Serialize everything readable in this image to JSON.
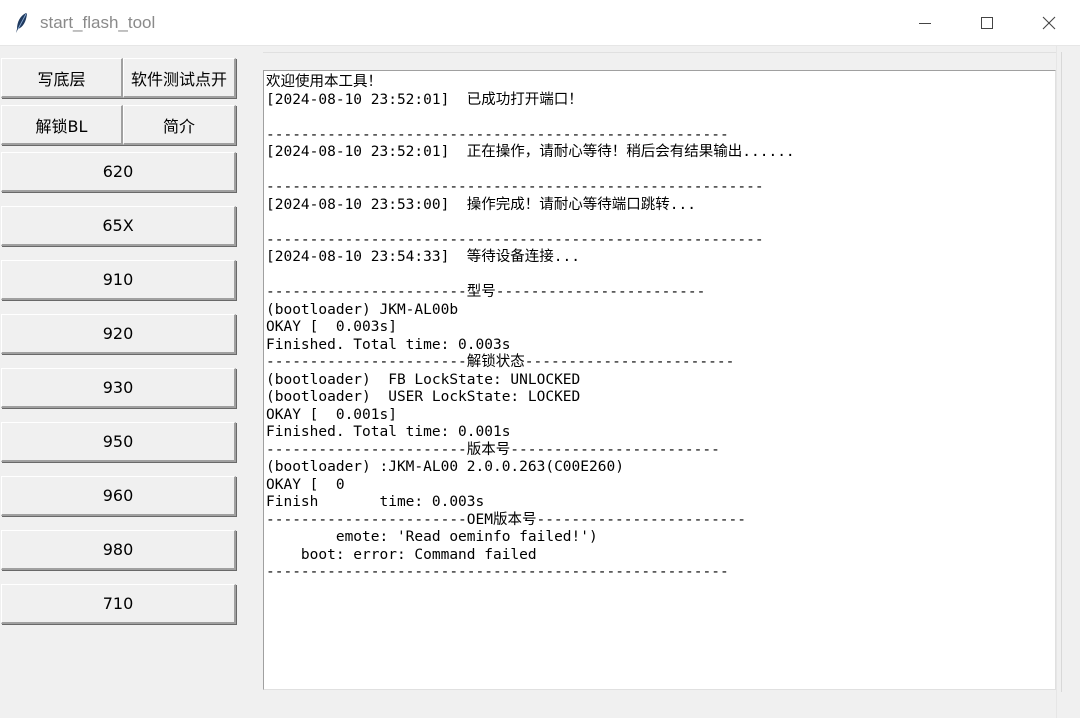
{
  "window": {
    "title": "start_flash_tool",
    "icon": "feather-icon",
    "controls": [
      "minimize-icon",
      "maximize-icon",
      "close-icon"
    ]
  },
  "buttons": {
    "write_base": "写底层",
    "software_test_point": "软件测试点开",
    "unlock_bl": "解锁BL",
    "intro": "简介",
    "models": [
      "620",
      "65X",
      "910",
      "920",
      "930",
      "950",
      "960",
      "980",
      "710"
    ]
  },
  "log": {
    "text": "欢迎使用本工具！\n[2024-08-10 23:52:01]  已成功打开端口！\n\n-----------------------------------------------------\n[2024-08-10 23:52:01]  正在操作，请耐心等待！稍后会有结果输出......\n\n---------------------------------------------------------\n[2024-08-10 23:53:00]  操作完成！请耐心等待端口跳转...\n\n---------------------------------------------------------\n[2024-08-10 23:54:33]  等待设备连接...\n\n-----------------------型号------------------------\n(bootloader) JKM-AL00b\nOKAY [  0.003s]\nFinished. Total time: 0.003s\n-----------------------解锁状态------------------------\n(bootloader)  FB LockState: UNLOCKED\n(bootloader)  USER LockState: LOCKED\nOKAY [  0.001s]\nFinished. Total time: 0.001s\n-----------------------版本号------------------------\n(bootloader) :JKM-AL00 2.0.0.263(C00E260)\nOKAY [  0\nFinish       time: 0.003s\n-----------------------OEM版本号------------------------\n        emote: 'Read oeminfo failed!')\n    boot: error: Command failed\n-----------------------------------------------------"
  }
}
